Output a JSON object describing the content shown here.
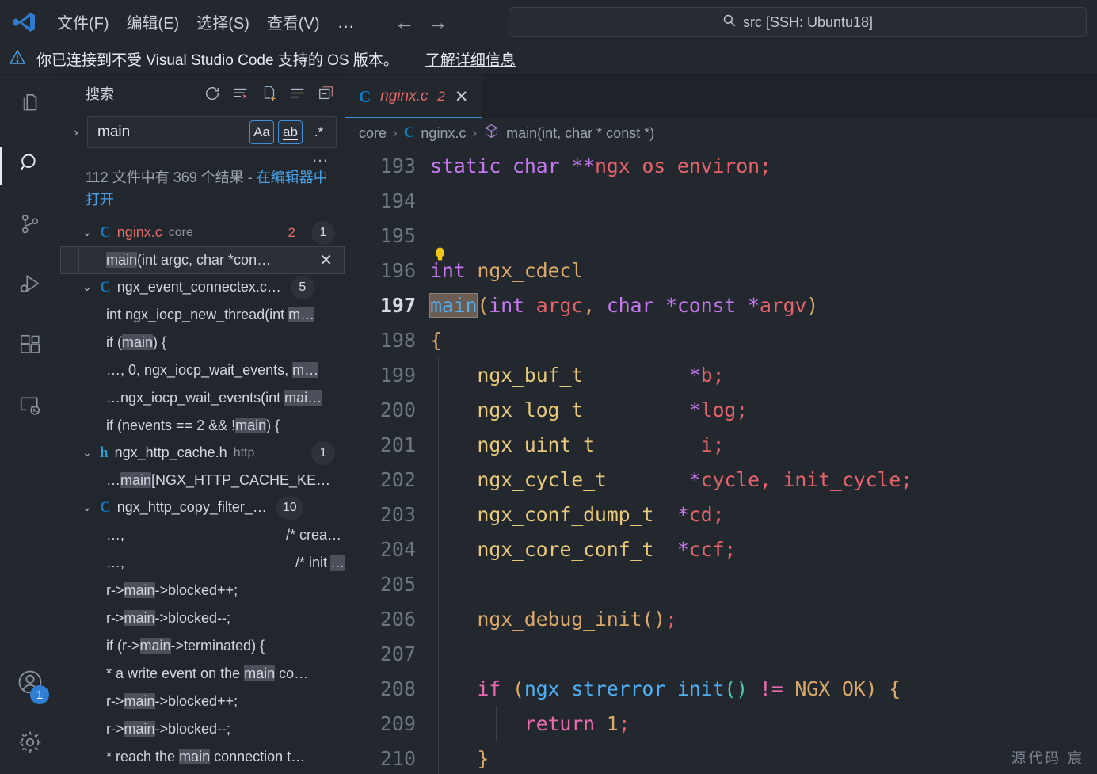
{
  "titlebar": {
    "logo": "vscode-logo",
    "menus": [
      "文件(F)",
      "编辑(E)",
      "选择(S)",
      "查看(V)"
    ],
    "more": "…",
    "nav_back": "←",
    "nav_forward": "→",
    "command_center": {
      "icon": "search-icon",
      "text": "src [SSH: Ubuntu18]"
    }
  },
  "banner": {
    "icon": "warning-icon",
    "text": "你已连接到不受 Visual Studio Code 支持的 OS 版本。",
    "link": "了解详细信息"
  },
  "activitybar": {
    "items": [
      {
        "name": "explorer",
        "icon": "files-icon",
        "active": false
      },
      {
        "name": "search",
        "icon": "search-icon",
        "active": true
      },
      {
        "name": "source-control",
        "icon": "source-control-icon",
        "active": false
      },
      {
        "name": "run-debug",
        "icon": "run-debug-icon",
        "active": false
      },
      {
        "name": "extensions",
        "icon": "extensions-icon",
        "active": false
      },
      {
        "name": "remote-explorer",
        "icon": "remote-explorer-icon",
        "active": false
      }
    ],
    "account": {
      "icon": "account-icon",
      "badge": "1"
    },
    "settings": {
      "icon": "gear-icon"
    }
  },
  "sidebar": {
    "title": "搜索",
    "actions": [
      {
        "name": "refresh",
        "icon": "refresh-icon"
      },
      {
        "name": "clear-results",
        "icon": "clear-all-icon"
      },
      {
        "name": "open-new-search-editor",
        "icon": "new-file-icon"
      },
      {
        "name": "view-as-tree",
        "icon": "list-icon"
      },
      {
        "name": "collapse-all",
        "icon": "collapse-all-icon"
      }
    ],
    "expand_chevron": "›",
    "search": {
      "value": "main",
      "placeholder": "搜索",
      "toggles": [
        {
          "name": "match-case",
          "label": "Aa",
          "on": true
        },
        {
          "name": "match-whole-word",
          "label": "ab",
          "on": true
        },
        {
          "name": "use-regex",
          "label": ".*",
          "on": false
        }
      ],
      "more": "…"
    },
    "summary": {
      "text": "112 文件中有 369 个结果 - ",
      "link": "在编辑器中打开"
    },
    "results": [
      {
        "file": "nginx.c",
        "ext": "C",
        "icon_kind": "c",
        "folder": "core",
        "error_count": "2",
        "badge": "1",
        "expanded": true,
        "error": true,
        "matches": [
          {
            "pre": "",
            "hit": "main",
            "post": "(int argc, char *con…",
            "selected": true,
            "close": "✕"
          }
        ]
      },
      {
        "file": "ngx_event_connectex.c…",
        "ext": "C",
        "icon_kind": "c",
        "folder": "",
        "badge": "5",
        "badge_inline": true,
        "expanded": true,
        "matches": [
          {
            "pre": "int ngx_iocp_new_thread(int ",
            "hit": "m…",
            "post": ""
          },
          {
            "pre": "if (",
            "hit": "main",
            "post": ") {"
          },
          {
            "pre": "…, 0, ngx_iocp_wait_events, ",
            "hit": "m…",
            "post": ""
          },
          {
            "pre": "…ngx_iocp_wait_events(int ",
            "hit": "mai…",
            "post": ""
          },
          {
            "pre": "if (nevents == 2 && !",
            "hit": "main",
            "post": ") {"
          }
        ]
      },
      {
        "file": "ngx_http_cache.h",
        "ext": "h",
        "icon_kind": "h",
        "folder": "http",
        "badge": "1",
        "expanded": true,
        "matches": [
          {
            "pre": "…",
            "hit": "main",
            "post": "[NGX_HTTP_CACHE_KE…"
          }
        ]
      },
      {
        "file": "ngx_http_copy_filter_…",
        "ext": "C",
        "icon_kind": "c",
        "folder": "",
        "badge": "10",
        "badge_inline": true,
        "expanded": true,
        "matches": [
          {
            "pre": "…,",
            "hit": "",
            "post": "",
            "right": "/* crea…"
          },
          {
            "pre": "…,",
            "hit": "",
            "post": "",
            "right": "/* init ",
            "right_hit": "…"
          },
          {
            "pre": "r->",
            "hit": "main",
            "post": "->blocked++;"
          },
          {
            "pre": "r->",
            "hit": "main",
            "post": "->blocked--;"
          },
          {
            "pre": "if (r->",
            "hit": "main",
            "post": "->terminated) {"
          },
          {
            "pre": "* a write event on the ",
            "hit": "main",
            "post": " co…"
          },
          {
            "pre": "r->",
            "hit": "main",
            "post": "->blocked++;"
          },
          {
            "pre": "r->",
            "hit": "main",
            "post": "->blocked--;"
          },
          {
            "pre": "* reach the ",
            "hit": "main",
            "post": " connection t…"
          }
        ]
      }
    ]
  },
  "editor": {
    "tabs": [
      {
        "label": "nginx.c",
        "icon": "c-file-icon",
        "count": "2",
        "close": "✕",
        "active": true,
        "error": true
      }
    ],
    "breadcrumb": [
      {
        "text": "core",
        "icon": ""
      },
      {
        "text": "nginx.c",
        "icon": "c-file-icon"
      },
      {
        "text": "main(int, char * const *)",
        "icon": "symbol-method-icon"
      }
    ],
    "separator": "›",
    "watermark": "源代码  宸",
    "lines": [
      {
        "n": "193",
        "tokens": [
          {
            "t": "static ",
            "c": "t-kw"
          },
          {
            "t": "char ",
            "c": "t-kw"
          },
          {
            "t": "**",
            "c": "t-kw"
          },
          {
            "t": "ngx_os_environ",
            "c": "t-var"
          },
          {
            "t": ";",
            "c": "t-var"
          }
        ],
        "indent": 0
      },
      {
        "n": "194",
        "tokens": [],
        "indent": 0
      },
      {
        "n": "195",
        "tokens": [],
        "indent": 0
      },
      {
        "n": "196",
        "tokens": [
          {
            "t": "int ",
            "c": "t-kw"
          },
          {
            "t": "ngx_cdecl",
            "c": "t-fn"
          }
        ],
        "indent": 0,
        "bulb": true
      },
      {
        "n": "197",
        "tokens": [
          {
            "t": "main",
            "c": "wordhl"
          },
          {
            "t": "(",
            "c": "t-punc"
          },
          {
            "t": "int ",
            "c": "t-kw"
          },
          {
            "t": "argc",
            "c": "t-var"
          },
          {
            "t": ", ",
            "c": "t-punc"
          },
          {
            "t": "char ",
            "c": "t-kw"
          },
          {
            "t": "*",
            "c": "t-kw"
          },
          {
            "t": "const ",
            "c": "t-kw"
          },
          {
            "t": "*",
            "c": "t-kw"
          },
          {
            "t": "argv",
            "c": "t-var"
          },
          {
            "t": ")",
            "c": "t-punc"
          }
        ],
        "indent": 0,
        "current": true
      },
      {
        "n": "198",
        "tokens": [
          {
            "t": "{",
            "c": "t-punc"
          }
        ],
        "indent": 0
      },
      {
        "n": "199",
        "tokens": [
          {
            "t": "    ngx_buf_t",
            "c": "t-type"
          },
          {
            "t": "         ",
            "c": "t-plain"
          },
          {
            "t": "*",
            "c": "t-kw"
          },
          {
            "t": "b;",
            "c": "t-var"
          }
        ],
        "indent": 1
      },
      {
        "n": "200",
        "tokens": [
          {
            "t": "    ngx_log_t",
            "c": "t-type"
          },
          {
            "t": "         ",
            "c": "t-plain"
          },
          {
            "t": "*",
            "c": "t-kw"
          },
          {
            "t": "log;",
            "c": "t-var"
          }
        ],
        "indent": 1
      },
      {
        "n": "201",
        "tokens": [
          {
            "t": "    ngx_uint_t",
            "c": "t-type"
          },
          {
            "t": "         ",
            "c": "t-plain"
          },
          {
            "t": "i;",
            "c": "t-var"
          }
        ],
        "indent": 1
      },
      {
        "n": "202",
        "tokens": [
          {
            "t": "    ngx_cycle_t",
            "c": "t-type"
          },
          {
            "t": "       ",
            "c": "t-plain"
          },
          {
            "t": "*",
            "c": "t-kw"
          },
          {
            "t": "cycle, init_cycle;",
            "c": "t-var"
          }
        ],
        "indent": 1
      },
      {
        "n": "203",
        "tokens": [
          {
            "t": "    ngx_conf_dump_t",
            "c": "t-type"
          },
          {
            "t": "  ",
            "c": "t-plain"
          },
          {
            "t": "*",
            "c": "t-kw"
          },
          {
            "t": "cd;",
            "c": "t-var"
          }
        ],
        "indent": 1
      },
      {
        "n": "204",
        "tokens": [
          {
            "t": "    ngx_core_conf_t",
            "c": "t-type"
          },
          {
            "t": "  ",
            "c": "t-plain"
          },
          {
            "t": "*",
            "c": "t-kw"
          },
          {
            "t": "ccf;",
            "c": "t-var"
          }
        ],
        "indent": 1
      },
      {
        "n": "205",
        "tokens": [],
        "indent": 1
      },
      {
        "n": "206",
        "tokens": [
          {
            "t": "    ngx_debug_init",
            "c": "t-fn"
          },
          {
            "t": "()",
            "c": "t-punc"
          },
          {
            "t": ";",
            "c": "t-var"
          }
        ],
        "indent": 1
      },
      {
        "n": "207",
        "tokens": [],
        "indent": 1
      },
      {
        "n": "208",
        "tokens": [
          {
            "t": "    if ",
            "c": "t-kw2"
          },
          {
            "t": "(",
            "c": "t-punc"
          },
          {
            "t": "ngx_strerror_init",
            "c": "t-fn2"
          },
          {
            "t": "()",
            "c": "t-op"
          },
          {
            "t": " != ",
            "c": "t-kw2"
          },
          {
            "t": "NGX_OK",
            "c": "t-const"
          },
          {
            "t": ")",
            "c": "t-punc"
          },
          {
            "t": " {",
            "c": "t-punc"
          }
        ],
        "indent": 1
      },
      {
        "n": "209",
        "tokens": [
          {
            "t": "        return ",
            "c": "t-kw2"
          },
          {
            "t": "1",
            "c": "t-num"
          },
          {
            "t": ";",
            "c": "t-var"
          }
        ],
        "indent": 2
      },
      {
        "n": "210",
        "tokens": [
          {
            "t": "    }",
            "c": "t-punc"
          }
        ],
        "indent": 1
      }
    ]
  }
}
